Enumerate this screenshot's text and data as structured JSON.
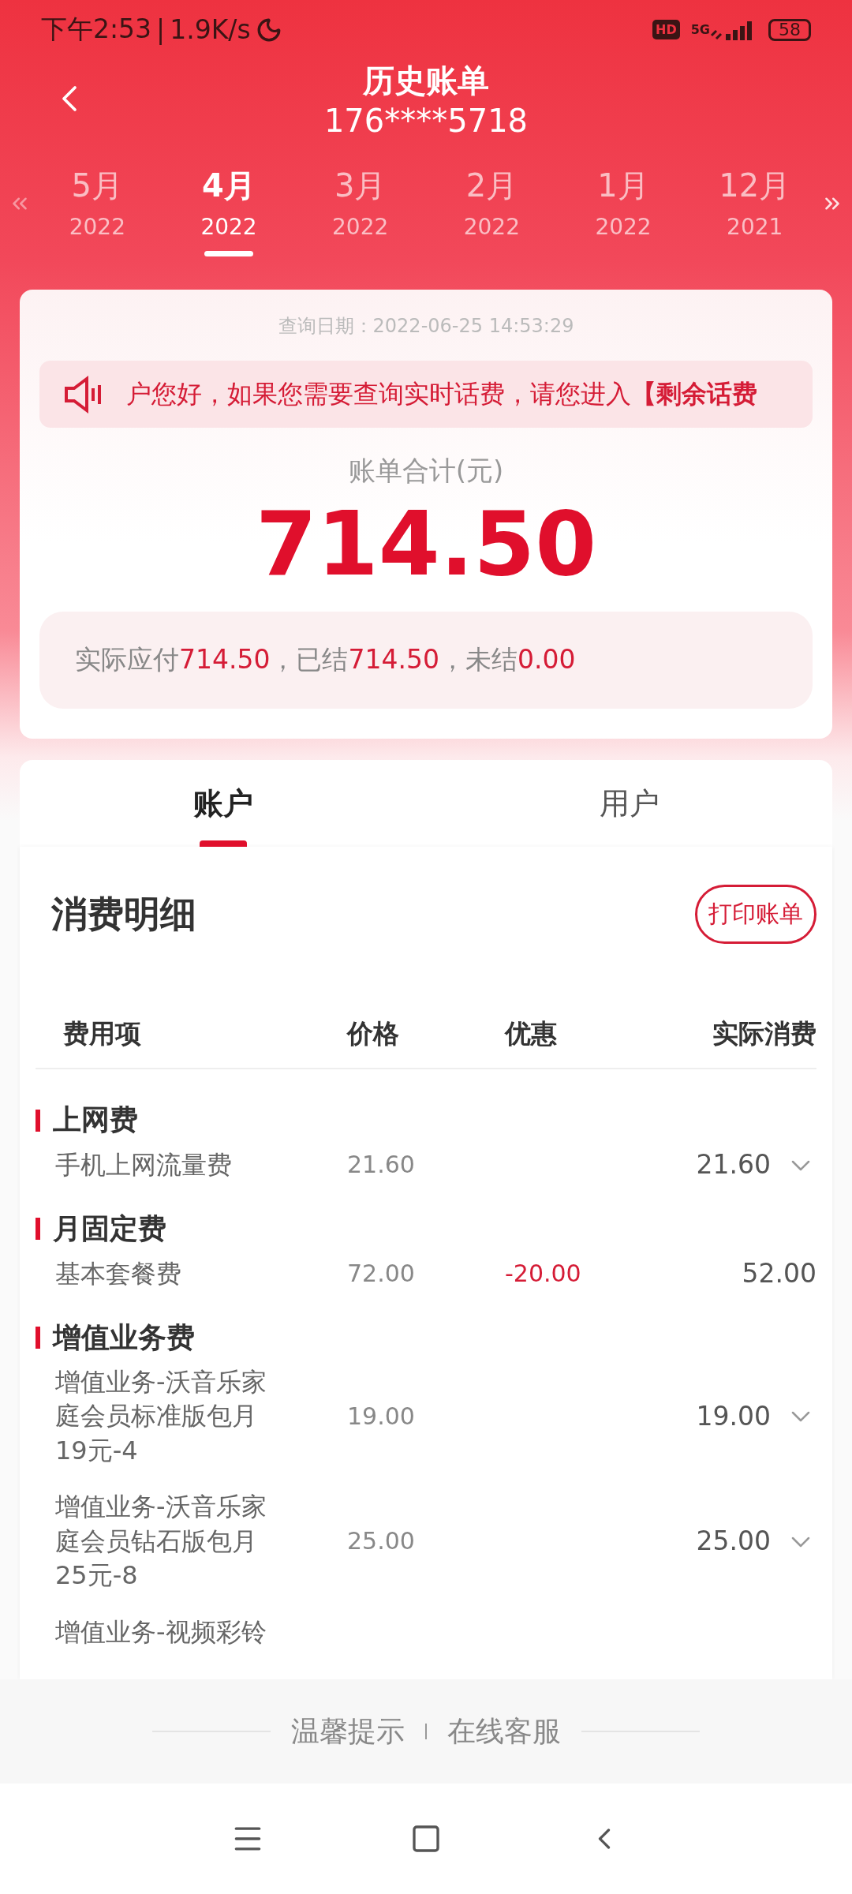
{
  "status_bar": {
    "time": "下午2:53",
    "separator": "|",
    "speed": "1.9K/s",
    "hd": "HD",
    "network": "5G",
    "battery": "58"
  },
  "header": {
    "title": "历史账单",
    "subtitle": "176****5718"
  },
  "months": [
    {
      "month": "5月",
      "year": "2022",
      "selected": false
    },
    {
      "month": "4月",
      "year": "2022",
      "selected": true
    },
    {
      "month": "3月",
      "year": "2022",
      "selected": false
    },
    {
      "month": "2月",
      "year": "2022",
      "selected": false
    },
    {
      "month": "1月",
      "year": "2022",
      "selected": false
    },
    {
      "month": "12月",
      "year": "2021",
      "selected": false
    }
  ],
  "bill_card": {
    "query_date": "查询日期：2022-06-25 14:53:29",
    "notice": "户您好，如果您需要查询实时话费，请您进入**【剩余话费**",
    "total_label": "账单合计(元)",
    "total": "714.50",
    "summary": [
      {
        "text": "实际应付",
        "kind": "label"
      },
      {
        "text": "714.50",
        "kind": "value"
      },
      {
        "text": "，已结",
        "kind": "label"
      },
      {
        "text": "714.50",
        "kind": "value"
      },
      {
        "text": "，未结",
        "kind": "label"
      },
      {
        "text": "0.00",
        "kind": "value"
      }
    ]
  },
  "tabs": [
    {
      "label": "账户",
      "selected": true
    },
    {
      "label": "用户",
      "selected": false
    }
  ],
  "details": {
    "title": "消费明细",
    "print_button": "打印账单",
    "columns": [
      "费用项",
      "价格",
      "优惠",
      "实际消费"
    ],
    "groups": [
      {
        "name": "上网费",
        "items": [
          {
            "name": "手机上网流量费",
            "price": "21.60",
            "actual": "21.60",
            "expandable": true
          }
        ]
      },
      {
        "name": "月固定费",
        "items": [
          {
            "name": "基本套餐费",
            "price": "72.00",
            "discount": "-20.00",
            "actual": "52.00",
            "expandable": false
          }
        ]
      },
      {
        "name": "增值业务费",
        "items": [
          {
            "name": "增值业务-沃音乐家庭会员标准版包月19元-4",
            "price": "19.00",
            "actual": "19.00",
            "expandable": true
          },
          {
            "name": "增值业务-沃音乐家庭会员钻石版包月25元-8",
            "price": "25.00",
            "actual": "25.00",
            "expandable": true
          },
          {
            "name": "增值业务-视频彩铃"
          }
        ]
      }
    ]
  },
  "footer": {
    "links": [
      "温馨提示",
      "在线客服"
    ]
  }
}
